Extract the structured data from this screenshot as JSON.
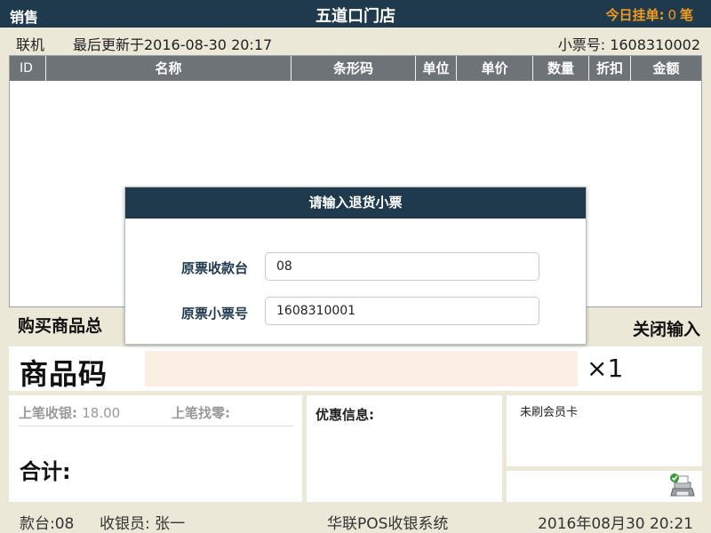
{
  "header": {
    "mode": "销售",
    "store_name": "五道口门店",
    "hold_label": "今日挂单:",
    "hold_count": "0",
    "hold_unit": "笔"
  },
  "status": {
    "connection": "联机",
    "last_updated": "最后更新于2016-08-30 20:17",
    "receipt_no": "小票号: 1608310002"
  },
  "table": {
    "columns": [
      "ID",
      "名称",
      "条形码",
      "单位",
      "单价",
      "数量",
      "折扣",
      "金额"
    ]
  },
  "summary": {
    "total_items_label": "购买商品总",
    "close_input": "关闭输入"
  },
  "code_entry": {
    "label": "商品码",
    "value": "",
    "multiplier": "×1"
  },
  "payment": {
    "last_received_label": "上笔收银:",
    "last_received_value": "18.00",
    "last_change_label": "上笔找零:",
    "total_label": "合计:"
  },
  "promo": {
    "label": "优惠信息:"
  },
  "member": {
    "status": "未刷会员卡"
  },
  "footer": {
    "station": "款台:08",
    "cashier": "收银员: 张一",
    "system": "华联POS收银系统",
    "datetime": "2016年08月30  20:21"
  },
  "dialog": {
    "title": "请输入退货小票",
    "field1_label": "原票收款台",
    "field1_value": "08",
    "field2_label": "原票小票号",
    "field2_value": "1608310001"
  },
  "colors": {
    "header_bg": "#1f3a4d",
    "accent_orange": "#f39a1e",
    "table_header_bg": "#6e7378",
    "code_input_bg": "#fbeee2",
    "app_bg": "#ece8d8"
  },
  "icons": {
    "printer": "printer-icon"
  }
}
